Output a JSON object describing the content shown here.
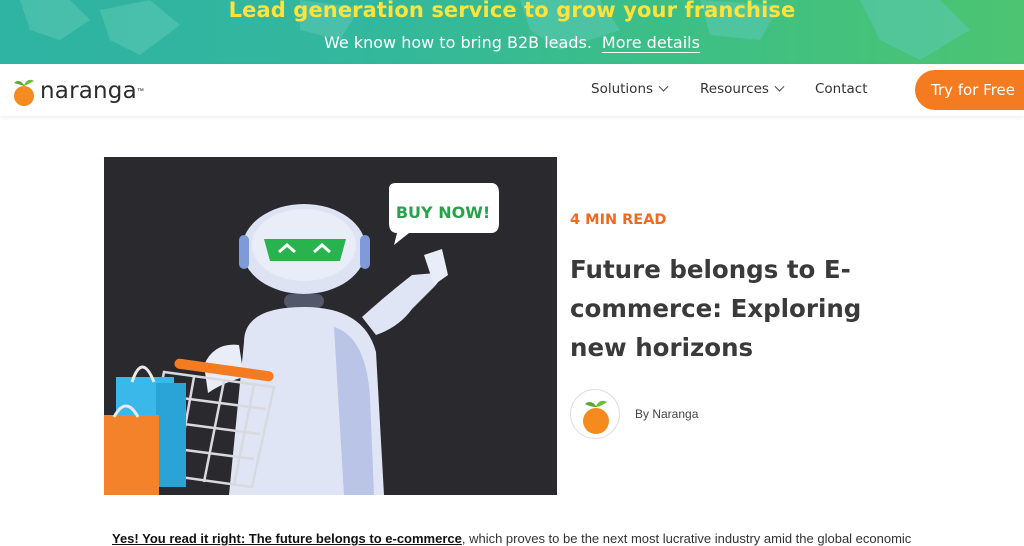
{
  "banner": {
    "title": "Lead generation service to grow your franchise",
    "subtitle": "We know how to bring B2B leads.",
    "link_label": "More details"
  },
  "nav": {
    "logo_text": "naranga",
    "items": [
      {
        "label": "Solutions"
      },
      {
        "label": "Resources"
      },
      {
        "label": "Contact"
      }
    ],
    "cta_label": "Try for Free"
  },
  "hero": {
    "speech_bubble": "BUY NOW!"
  },
  "post": {
    "read_time": "4 MIN READ",
    "title": "Future belongs to E-commerce: Exploring new horizons",
    "author": "By Naranga",
    "intro_lead": "Yes! You read it right: The future belongs to e-commerce",
    "intro_rest": ", which proves to be the next most lucrative industry amid the global economic"
  },
  "colors": {
    "accent_orange": "#f47b20",
    "banner_yellow": "#ffe23a",
    "banner_teal": "#33b79d"
  }
}
